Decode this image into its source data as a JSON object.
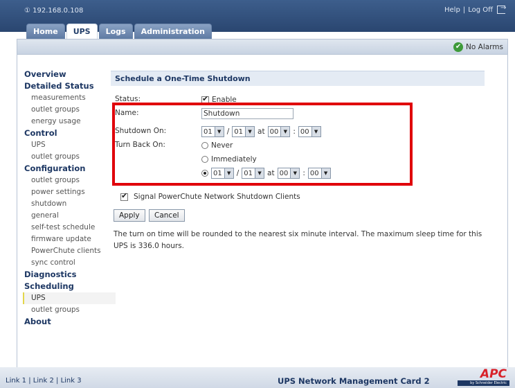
{
  "header": {
    "ip": "① 192.168.0.108",
    "help": "Help",
    "divider": "|",
    "logoff": "Log Off"
  },
  "tabs": [
    {
      "label": "Home"
    },
    {
      "label": "UPS"
    },
    {
      "label": "Logs"
    },
    {
      "label": "Administration"
    }
  ],
  "alarm": {
    "text": "No Alarms",
    "color": "#3e9a3a"
  },
  "sidebar": {
    "overview": "Overview",
    "detailed_status": "Detailed Status",
    "measurements": "measurements",
    "outlet_groups_1": "outlet groups",
    "energy_usage": "energy usage",
    "control": "Control",
    "ups_1": "UPS",
    "outlet_groups_2": "outlet groups",
    "configuration": "Configuration",
    "outlet_groups_3": "outlet groups",
    "power_settings": "power settings",
    "shutdown": "shutdown",
    "general": "general",
    "self_test": "self-test schedule",
    "firmware": "firmware update",
    "powerchute": "PowerChute clients",
    "sync": "sync control",
    "diagnostics": "Diagnostics",
    "scheduling": "Scheduling",
    "ups_2": "UPS",
    "outlet_groups_4": "outlet groups",
    "about": "About"
  },
  "form": {
    "title": "Schedule a One-Time Shutdown",
    "status_label": "Status:",
    "enable_label": "Enable",
    "name_label": "Name:",
    "name_value": "Shutdown",
    "shutdown_on_label": "Shutdown On:",
    "turn_back_label": "Turn Back On:",
    "never": "Never",
    "immediately": "Immediately",
    "month": "01",
    "day": "01",
    "hour": "00",
    "minute": "00",
    "slash": "/",
    "at": "at",
    "colon": ":",
    "signal_label": "Signal PowerChute Network Shutdown Clients",
    "apply": "Apply",
    "cancel": "Cancel",
    "note": "The turn on time will be rounded to the nearest six minute interval. The maximum sleep time for this UPS is 336.0 hours."
  },
  "footer": {
    "link1": "Link 1",
    "link2": "Link 2",
    "link3": "Link 3",
    "sep": "|",
    "product": "UPS Network Management Card 2",
    "logo": "APC",
    "logo_sub": "by Schneider Electric"
  },
  "colors": {
    "brand": "#1d3763",
    "highlight": "#e0000a",
    "logo": "#d8222a"
  }
}
